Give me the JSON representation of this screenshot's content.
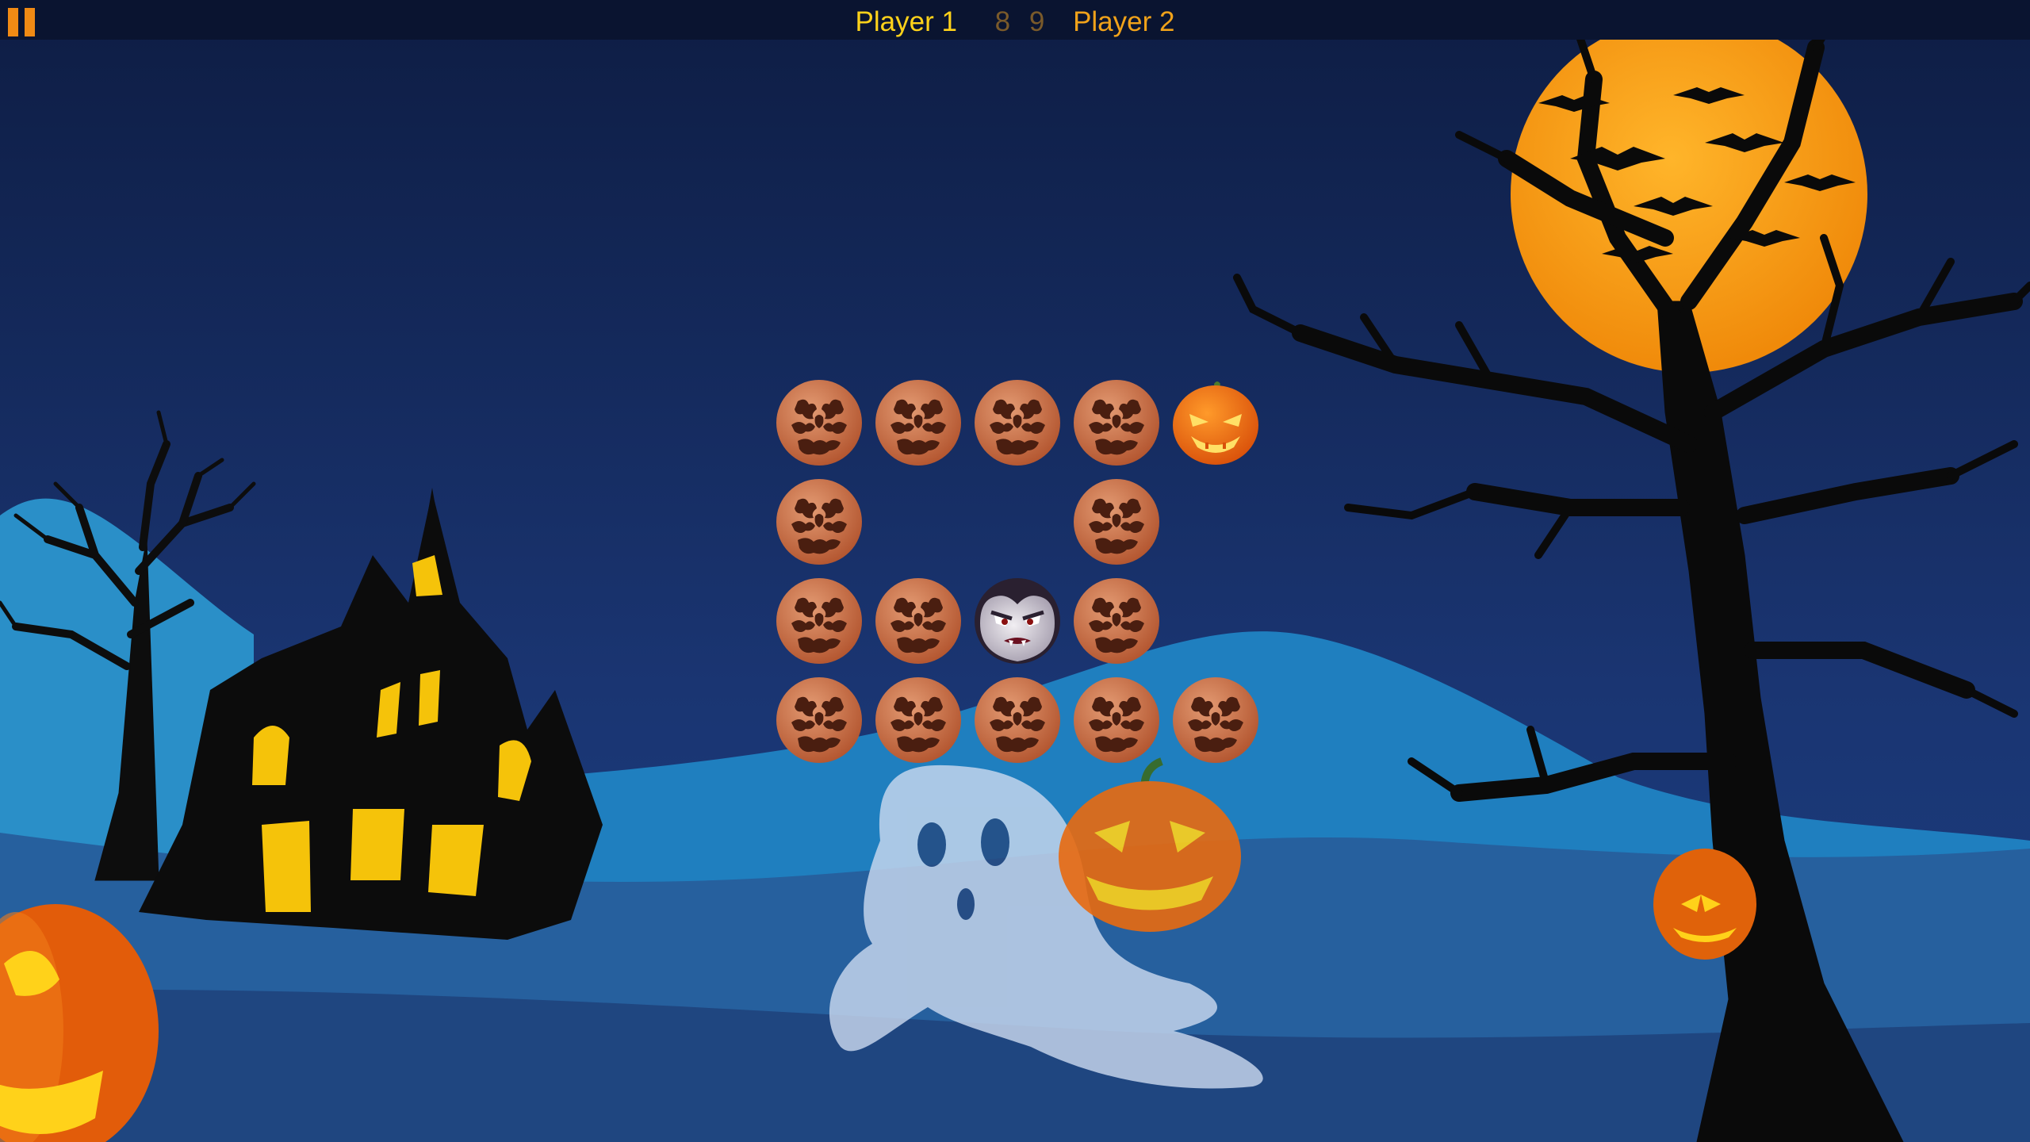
{
  "game": {
    "title_hint": "",
    "player1_label": "Player 1",
    "player2_label": "Player 2",
    "player1_score": "8",
    "player2_score": "9",
    "colors": {
      "topbar": "#0a1430",
      "player1": "#ffd21a",
      "player2": "#f0a21a",
      "score": "#7a5a2a",
      "sky": "#14285a",
      "moon": "#f7a514"
    }
  },
  "board": {
    "rows": [
      [
        "hidden",
        "hidden",
        "hidden",
        "hidden",
        "pumpkin"
      ],
      [
        "hidden",
        null,
        null,
        "hidden",
        null
      ],
      [
        "hidden",
        "hidden",
        "vampire",
        "hidden",
        null
      ],
      [
        "hidden",
        "hidden",
        "hidden",
        "hidden",
        "hidden"
      ]
    ]
  },
  "icons": {
    "pause": "pause-icon",
    "hidden_tile": "cracked-pumpkin-tile-icon",
    "pumpkin": "jack-o-lantern-icon",
    "vampire": "vampire-face-icon"
  }
}
